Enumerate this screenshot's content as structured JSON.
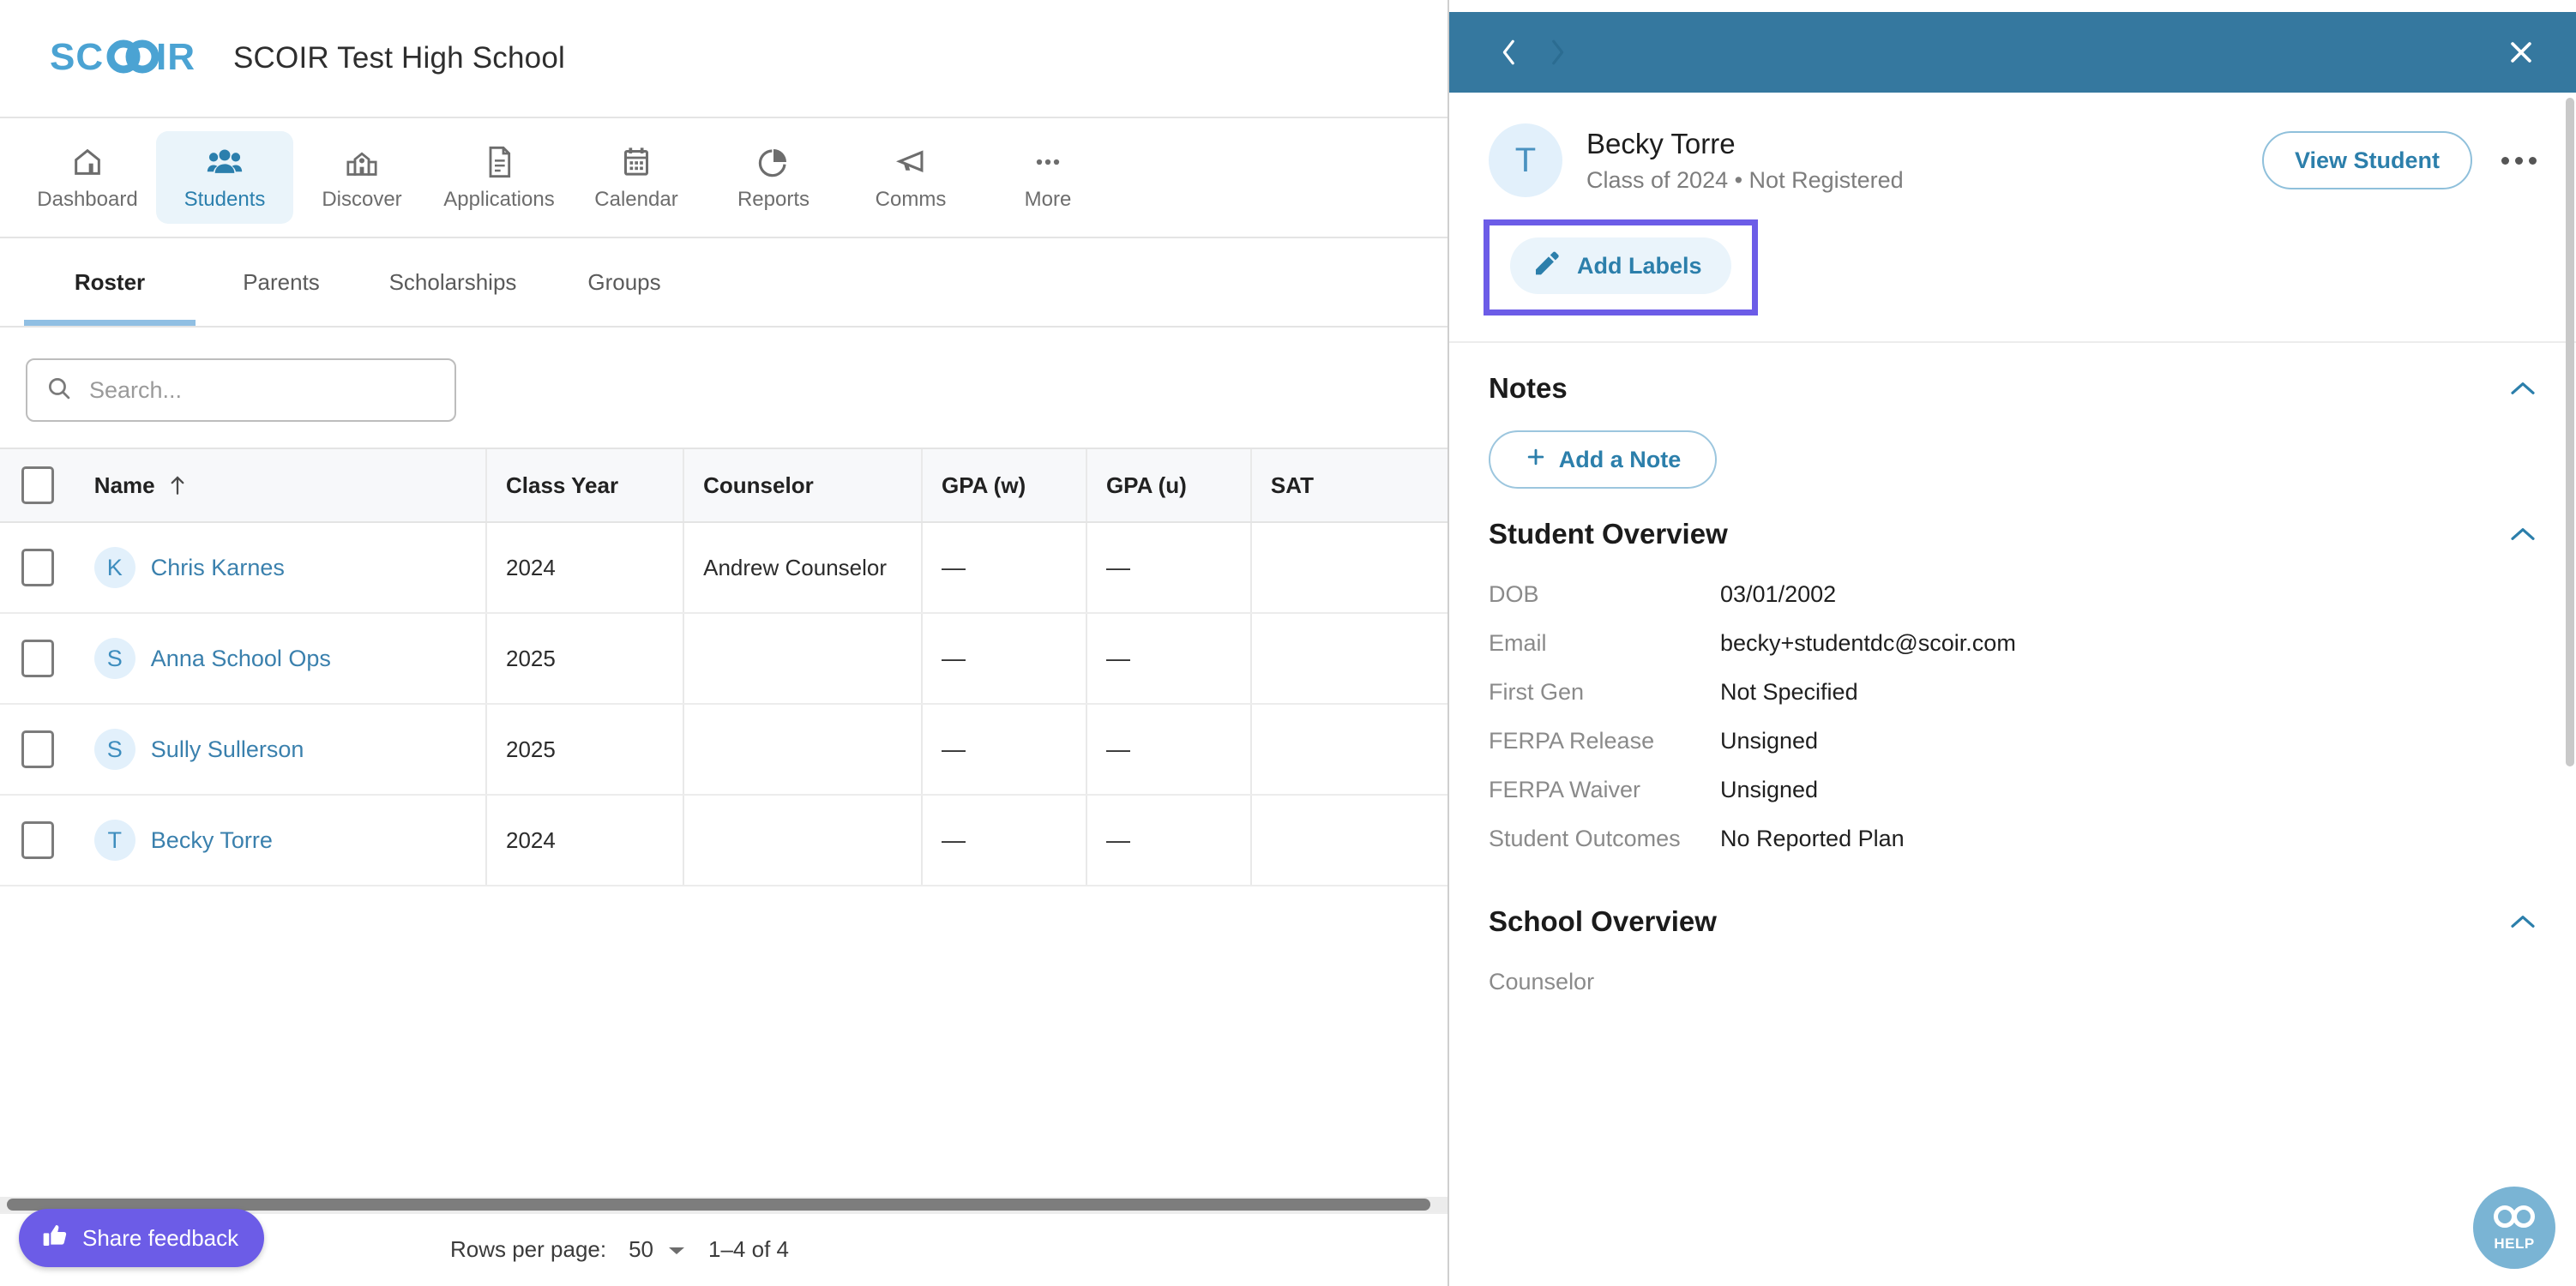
{
  "header": {
    "logo_text": "SCOIR",
    "school_title": "SCOIR Test High School"
  },
  "mainnav": {
    "items": [
      {
        "label": "Dashboard",
        "icon": "home-icon",
        "active": false
      },
      {
        "label": "Students",
        "icon": "people-icon",
        "active": true
      },
      {
        "label": "Discover",
        "icon": "school-building-icon",
        "active": false
      },
      {
        "label": "Applications",
        "icon": "document-icon",
        "active": false
      },
      {
        "label": "Calendar",
        "icon": "calendar-icon",
        "active": false
      },
      {
        "label": "Reports",
        "icon": "pie-chart-icon",
        "active": false
      },
      {
        "label": "Comms",
        "icon": "megaphone-icon",
        "active": false
      },
      {
        "label": "More",
        "icon": "ellipsis-icon",
        "active": false
      }
    ]
  },
  "subtabs": {
    "items": [
      {
        "label": "Roster",
        "active": true
      },
      {
        "label": "Parents",
        "active": false
      },
      {
        "label": "Scholarships",
        "active": false
      },
      {
        "label": "Groups",
        "active": false
      }
    ]
  },
  "search": {
    "placeholder": "Search...",
    "value": "",
    "icon": "search-icon"
  },
  "table": {
    "columns": [
      "Name",
      "Class Year",
      "Counselor",
      "GPA (w)",
      "GPA (u)",
      "SAT"
    ],
    "sort_column": "Name",
    "sort_direction": "asc",
    "rows": [
      {
        "initial": "K",
        "name": "Chris Karnes",
        "class_year": "2024",
        "counselor": "Andrew Counselor",
        "gpa_w": "—",
        "gpa_u": "—",
        "sat": ""
      },
      {
        "initial": "S",
        "name": "Anna School Ops",
        "class_year": "2025",
        "counselor": "",
        "gpa_w": "—",
        "gpa_u": "—",
        "sat": ""
      },
      {
        "initial": "S",
        "name": "Sully Sullerson",
        "class_year": "2025",
        "counselor": "",
        "gpa_w": "—",
        "gpa_u": "—",
        "sat": ""
      },
      {
        "initial": "T",
        "name": "Becky Torre",
        "class_year": "2024",
        "counselor": "",
        "gpa_w": "—",
        "gpa_u": "—",
        "sat": ""
      }
    ]
  },
  "footer": {
    "feedback_label": "Share feedback",
    "feedback_icon": "thumbs-up-icon",
    "rows_per_page_label": "Rows per page:",
    "rows_per_page_value": "50",
    "range_label": "1–4 of 4"
  },
  "drawer": {
    "nav": {
      "back_icon": "chevron-left-icon",
      "forward_icon": "chevron-right-icon",
      "close_icon": "close-icon"
    },
    "student": {
      "initial": "T",
      "name": "Becky Torre",
      "subtitle": "Class of 2024 • Not Registered",
      "view_student_label": "View Student",
      "more_icon": "ellipsis-icon"
    },
    "add_labels": {
      "label": "Add Labels",
      "icon": "pencil-icon",
      "highlighted": true,
      "highlight_color": "#6c5ce7"
    },
    "notes": {
      "title": "Notes",
      "collapse_icon": "chevron-up-icon",
      "add_note_label": "Add a Note",
      "add_note_icon": "plus-icon"
    },
    "student_overview": {
      "title": "Student Overview",
      "collapse_icon": "chevron-up-icon",
      "fields": [
        {
          "key": "DOB",
          "value": "03/01/2002"
        },
        {
          "key": "Email",
          "value": "becky+studentdc@scoir.com"
        },
        {
          "key": "First Gen",
          "value": "Not Specified"
        },
        {
          "key": "FERPA Release",
          "value": "Unsigned"
        },
        {
          "key": "FERPA Waiver",
          "value": "Unsigned"
        },
        {
          "key": "Student Outcomes",
          "value": "No Reported Plan"
        }
      ]
    },
    "school_overview": {
      "title": "School Overview",
      "collapse_icon": "chevron-up-icon",
      "fields": [
        {
          "key": "Counselor",
          "value": ""
        }
      ]
    },
    "help": {
      "label": "HELP",
      "icon": "scoir-infinity-icon"
    }
  },
  "colors": {
    "brand_blue": "#35789f",
    "link_blue": "#2c7fab",
    "accent_purple": "#6c5ce7",
    "avatar_bg": "#e2f0fb"
  }
}
